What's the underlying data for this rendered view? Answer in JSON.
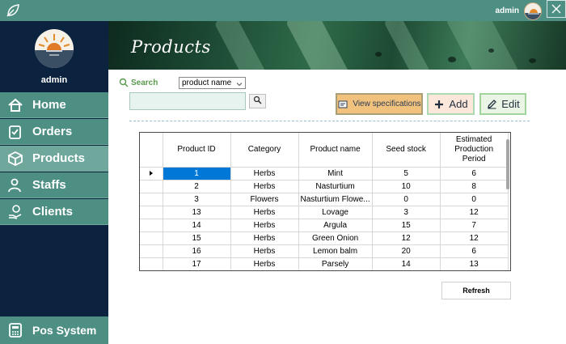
{
  "titlebar": {
    "username": "admin"
  },
  "sidebar": {
    "username": "admin",
    "items": [
      {
        "label": "Home",
        "icon": "home-icon"
      },
      {
        "label": "Orders",
        "icon": "clipboard-check-icon"
      },
      {
        "label": "Products",
        "icon": "box-icon",
        "active": true
      },
      {
        "label": "Staffs",
        "icon": "user-icon"
      },
      {
        "label": "Clients",
        "icon": "hand-money-icon"
      }
    ],
    "pos": {
      "label": "Pos System",
      "icon": "calculator-icon"
    }
  },
  "header": {
    "title": "Products"
  },
  "search": {
    "label": "Search",
    "field_selected": "product name",
    "query": ""
  },
  "toolbar": {
    "spec_label": "View specifications",
    "add_label": "Add",
    "edit_label": "Edit",
    "refresh_label": "Refresh"
  },
  "table": {
    "columns": [
      "Product ID",
      "Category",
      "Product name",
      "Seed stock",
      "Estimated Production Period"
    ],
    "rows": [
      [
        "1",
        "Herbs",
        "Mint",
        "5",
        "6"
      ],
      [
        "2",
        "Herbs",
        "Nasturtium",
        "10",
        "8"
      ],
      [
        "3",
        "Flowers",
        "Nasturtium Flowe...",
        "0",
        "0"
      ],
      [
        "13",
        "Herbs",
        "Lovage",
        "3",
        "12"
      ],
      [
        "14",
        "Herbs",
        "Argula",
        "15",
        "7"
      ],
      [
        "15",
        "Herbs",
        "Green Onion",
        "12",
        "12"
      ],
      [
        "16",
        "Herbs",
        "Lemon balm",
        "20",
        "6"
      ],
      [
        "17",
        "Herbs",
        "Parsely",
        "14",
        "13"
      ]
    ]
  },
  "colors": {
    "accent": "#4e8f84",
    "sidebar_bg": "#0c2340",
    "selection": "#0078d7",
    "spec_button": "#f1c27d"
  }
}
